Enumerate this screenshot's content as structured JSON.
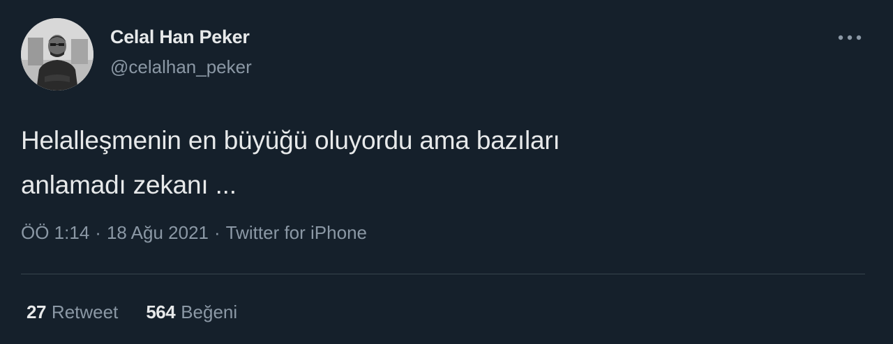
{
  "author": {
    "display_name": "Celal Han Peker",
    "handle": "@celalhan_peker"
  },
  "more_icon": "more-horizontal-icon",
  "tweet": {
    "line1": "Helalleşmenin en büyüğü oluyordu ama bazıları",
    "line2": "anlamadı zekanı ..."
  },
  "meta": {
    "time": "ÖÖ 1:14",
    "date": "18 Ağu 2021",
    "separator": "·",
    "source": "Twitter for iPhone"
  },
  "stats": {
    "retweets_count": "27",
    "retweets_label": "Retweet",
    "likes_count": "564",
    "likes_label": "Beğeni"
  },
  "colors": {
    "background": "#15202b",
    "text_primary": "#e7e9ea",
    "text_secondary": "#8b98a5",
    "divider": "#38444d"
  }
}
